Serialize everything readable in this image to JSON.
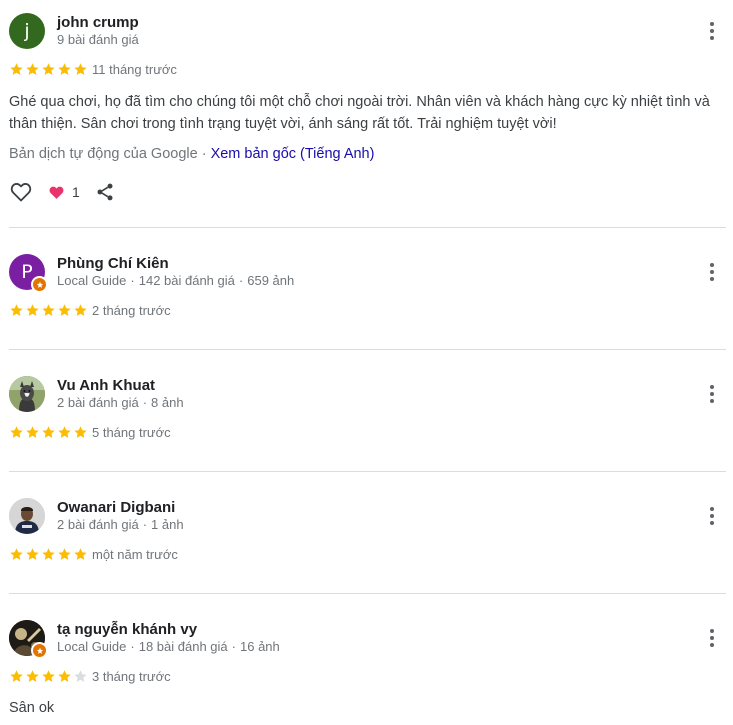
{
  "reviews": [
    {
      "name": "john crump",
      "meta": "9 bài đánh giá",
      "avatar_initial": "j",
      "avatar_color": "#33691e",
      "rating": 5,
      "time": "11 tháng trước",
      "text": "Ghé qua chơi, họ đã tìm cho chúng tôi một chỗ chơi ngoài trời. Nhân viên và khách hàng cực kỳ nhiệt tình và thân thiện. Sân chơi trong tình trạng tuyệt vời, ánh sáng rất tốt. Trải nghiệm tuyệt vời!",
      "translation_note": "Bản dịch tự động của Google",
      "translation_link": "Xem bản gốc (Tiếng Anh)",
      "like_count": "1"
    },
    {
      "name": "Phùng Chí Kiên",
      "meta_parts": [
        "Local Guide",
        "142 bài đánh giá",
        "659 ảnh"
      ],
      "avatar_initial": "P",
      "avatar_color": "#7b1fa2",
      "rating": 5,
      "time": "2 tháng trước"
    },
    {
      "name": "Vu Anh Khuat",
      "meta_parts": [
        "2 bài đánh giá",
        "8 ảnh"
      ],
      "rating": 5,
      "time": "5 tháng trước"
    },
    {
      "name": "Owanari Digbani",
      "meta_parts": [
        "2 bài đánh giá",
        "1 ảnh"
      ],
      "rating": 5,
      "time": "một năm trước"
    },
    {
      "name": "tạ nguyễn khánh vy",
      "meta_parts": [
        "Local Guide",
        "18 bài đánh giá",
        "16 ảnh"
      ],
      "rating": 4,
      "time": "3 tháng trước",
      "text": "Sân ok"
    }
  ],
  "colors": {
    "star_filled": "#fbbc04",
    "star_empty": "#dadce0",
    "heart": "#e8336d",
    "link": "#1a0dab",
    "local_guide_badge": "#e37400"
  }
}
